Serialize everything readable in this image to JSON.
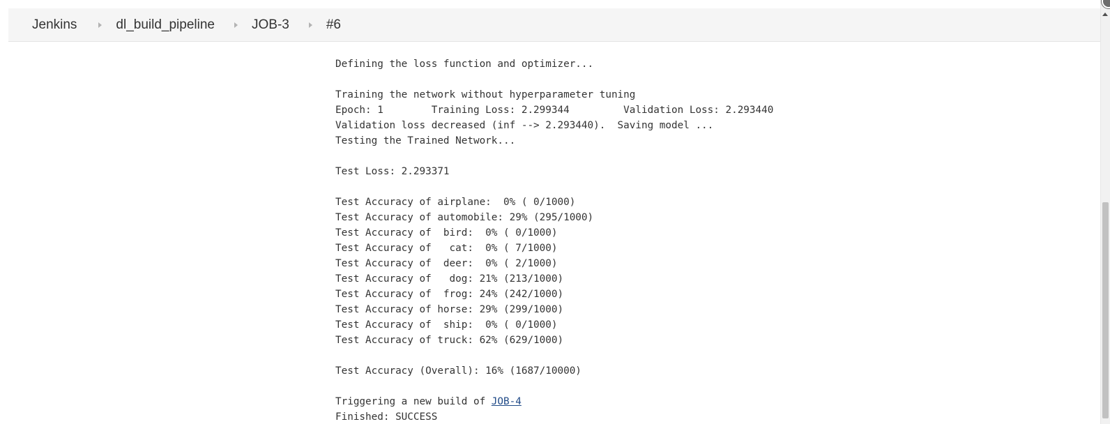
{
  "breadcrumb": {
    "items": [
      {
        "label": "Jenkins"
      },
      {
        "label": "dl_build_pipeline"
      },
      {
        "label": "JOB-3"
      },
      {
        "label": "#6"
      }
    ]
  },
  "console": {
    "lines": [
      "Defining the loss function and optimizer...",
      "",
      "Training the network without hyperparameter tuning",
      "Epoch: 1        Training Loss: 2.299344         Validation Loss: 2.293440",
      "Validation loss decreased (inf --> 2.293440).  Saving model ...",
      "Testing the Trained Network...",
      "",
      "Test Loss: 2.293371",
      "",
      "Test Accuracy of airplane:  0% ( 0/1000)",
      "Test Accuracy of automobile: 29% (295/1000)",
      "Test Accuracy of  bird:  0% ( 0/1000)",
      "Test Accuracy of   cat:  0% ( 7/1000)",
      "Test Accuracy of  deer:  0% ( 2/1000)",
      "Test Accuracy of   dog: 21% (213/1000)",
      "Test Accuracy of  frog: 24% (242/1000)",
      "Test Accuracy of horse: 29% (299/1000)",
      "Test Accuracy of  ship:  0% ( 0/1000)",
      "Test Accuracy of truck: 62% (629/1000)",
      "",
      "Test Accuracy (Overall): 16% (1687/10000)"
    ],
    "trigger_prefix": "Triggering a new build of ",
    "trigger_link": "JOB-4",
    "finished": "Finished: SUCCESS"
  },
  "colors": {
    "breadcrumb_bg": "#f5f5f5",
    "text": "#333333",
    "link": "#204a87"
  },
  "icons": {
    "breadcrumb_separator": "caret-right-icon",
    "scroll_up": "arrow-up-icon",
    "corner": "close-icon"
  }
}
